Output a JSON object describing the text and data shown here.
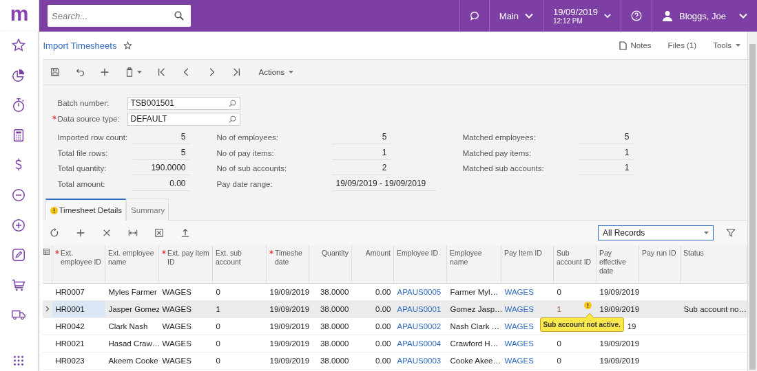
{
  "logo": "m",
  "topbar": {
    "search": {
      "placeholder": "Search..."
    },
    "company": "Main",
    "date": "19/09/2019",
    "time": "12:12 PM",
    "user": "Bloggs, Joe"
  },
  "page": {
    "title": "Import Timesheets",
    "links": [
      "Notes",
      "Files (1)",
      "Tools"
    ]
  },
  "toolbar": {
    "actions": "Actions"
  },
  "form": {
    "fields": [
      {
        "label": "Batch number:",
        "value": "TSB001501",
        "required": false
      },
      {
        "label": "Data source type:",
        "value": "DEFAULT",
        "required": true
      }
    ],
    "stats": [
      {
        "label": "Imported row count:",
        "value": "5"
      },
      {
        "label": "No of employees:",
        "value": "5"
      },
      {
        "label": "Matched employees:",
        "value": "5"
      },
      {
        "label": "Total file rows:",
        "value": "5"
      },
      {
        "label": "No of pay items:",
        "value": "1"
      },
      {
        "label": "Matched pay items:",
        "value": "1"
      },
      {
        "label": "Total quantity:",
        "value": "190.0000"
      },
      {
        "label": "No of sub accounts:",
        "value": "2"
      },
      {
        "label": "Matched sub accounts:",
        "value": "1"
      },
      {
        "label": "Total amount:",
        "value": "0.00"
      },
      {
        "label": "Pay date range:",
        "value": "19/09/2019 - 19/09/2019"
      }
    ]
  },
  "tabs": [
    {
      "label": "Timesheet Details",
      "selected": true,
      "warning": true
    },
    {
      "label": "Summary",
      "selected": false,
      "warning": false
    }
  ],
  "grid_filter": "All Records",
  "table": {
    "columns": [
      {
        "label": "Ext. employee ID",
        "required": true,
        "kind": "text"
      },
      {
        "label": "Ext. employee name",
        "required": false,
        "kind": "text"
      },
      {
        "label": "Ext. pay item ID",
        "required": true,
        "kind": "text"
      },
      {
        "label": "Ext. sub account",
        "required": false,
        "kind": "text"
      },
      {
        "label": "Timeshe date",
        "required": true,
        "kind": "text"
      },
      {
        "label": "Quantity",
        "required": false,
        "kind": "number"
      },
      {
        "label": "Amount",
        "required": false,
        "kind": "number"
      },
      {
        "label": "Employee ID",
        "required": false,
        "kind": "link"
      },
      {
        "label": "Employee name",
        "required": false,
        "kind": "text"
      },
      {
        "label": "Pay Item ID",
        "required": false,
        "kind": "link"
      },
      {
        "label": "Sub account ID",
        "required": false,
        "kind": "text"
      },
      {
        "label": "Pay effective date",
        "required": false,
        "kind": "text"
      },
      {
        "label": "Pay run ID",
        "required": false,
        "kind": "text"
      },
      {
        "label": "Status",
        "required": false,
        "kind": "text"
      }
    ],
    "rows": [
      {
        "selected": false,
        "warning": false,
        "cells": [
          "HR0007",
          "Myles Farmer",
          "WAGES",
          "0",
          "19/09/2019",
          "38.0000",
          "0.00",
          "APAUS0005",
          "Farmer Myl…",
          "WAGES",
          "0",
          "19/09/2019",
          "",
          ""
        ]
      },
      {
        "selected": true,
        "warning": true,
        "cells": [
          "HR0001",
          "Jasper Gomez",
          "WAGES",
          "1",
          "19/09/2019",
          "38.0000",
          "0.00",
          "APAUS0001",
          "Gomez Jasp…",
          "WAGES",
          "1",
          "19/09/2019",
          "",
          "Sub account no…"
        ]
      },
      {
        "selected": false,
        "warning": false,
        "cells": [
          "HR0042",
          "Clark Nash",
          "WAGES",
          "0",
          "19/09/2019",
          "38.0000",
          "0.00",
          "APAUS0002",
          "Nash Clark …",
          "WAGES",
          "",
          "19",
          "",
          ""
        ]
      },
      {
        "selected": false,
        "warning": false,
        "cells": [
          "HR0021",
          "Hasad Craw…",
          "WAGES",
          "0",
          "19/09/2019",
          "38.0000",
          "0.00",
          "APAUS0004",
          "Crawford H…",
          "WAGES",
          "0",
          "19/09/2019",
          "",
          ""
        ]
      },
      {
        "selected": false,
        "warning": false,
        "cells": [
          "HR0023",
          "Akeem Cooke",
          "WAGES",
          "0",
          "19/09/2019",
          "38.0000",
          "0.00",
          "APAUS0003",
          "Cooke Akee…",
          "WAGES",
          "0",
          "19/09/2019",
          "",
          ""
        ]
      }
    ],
    "tooltip": "Sub account not active."
  }
}
